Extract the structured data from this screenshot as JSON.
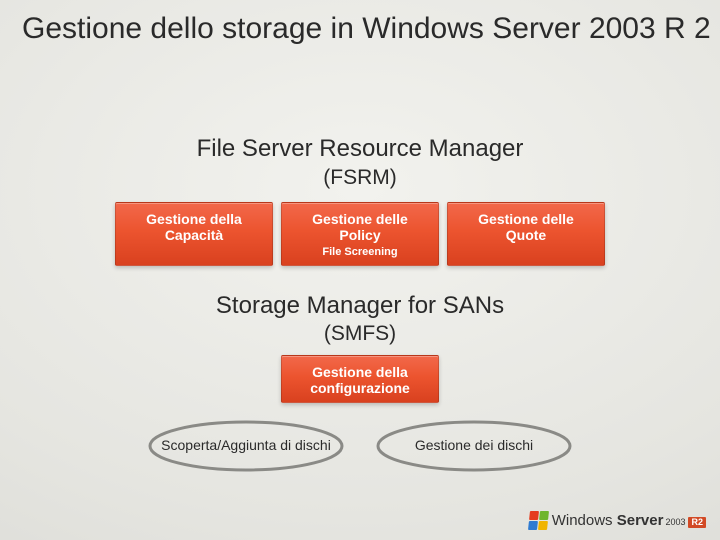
{
  "title": "Gestione dello storage in Windows Server 2003 R 2",
  "section1": {
    "heading": "File Server Resource Manager",
    "sub": "(FSRM)",
    "blocks": [
      {
        "line1": "Gestione della",
        "line2": "Capacità",
        "small": ""
      },
      {
        "line1": "Gestione delle",
        "line2": "Policy",
        "small": "File Screening"
      },
      {
        "line1": "Gestione delle",
        "line2": "Quote",
        "small": ""
      }
    ]
  },
  "section2": {
    "heading": "Storage Manager for SANs",
    "sub": "(SMFS)",
    "top": {
      "line1": "Gestione della",
      "line2": "configurazione"
    },
    "ellipses": [
      "Scoperta/Aggiunta di dischi",
      "Gestione dei dischi"
    ]
  },
  "footer": {
    "brand_prefix": "Windows",
    "brand_suffix": "Server",
    "year": "2003",
    "badge": "R2"
  }
}
